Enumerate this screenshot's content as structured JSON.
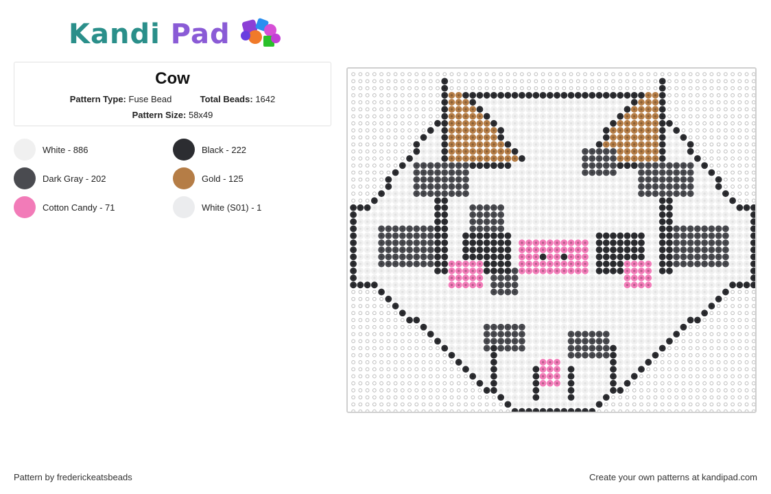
{
  "brand": {
    "name_part1": "Kandi",
    "name_part2": "Pad"
  },
  "pattern": {
    "title": "Cow",
    "type_label": "Pattern Type:",
    "type_value": "Fuse Bead",
    "beads_label": "Total Beads:",
    "beads_value": "1642",
    "size_label": "Pattern Size:",
    "size_value": "58x49"
  },
  "legend": [
    {
      "label": "White - 886",
      "color": "#f0f0f0"
    },
    {
      "label": "Black - 222",
      "color": "#2c2d31"
    },
    {
      "label": "Dark Gray - 202",
      "color": "#4a4b50"
    },
    {
      "label": "Gold - 125",
      "color": "#b57d46"
    },
    {
      "label": "Cotton Candy - 71",
      "color": "#f27bb8"
    },
    {
      "label": "White (S01) - 1",
      "color": "#ebecee"
    }
  ],
  "footer": {
    "credit": "Pattern by frederickeatsbeads",
    "cta": "Create your own patterns at kandipad.com"
  }
}
